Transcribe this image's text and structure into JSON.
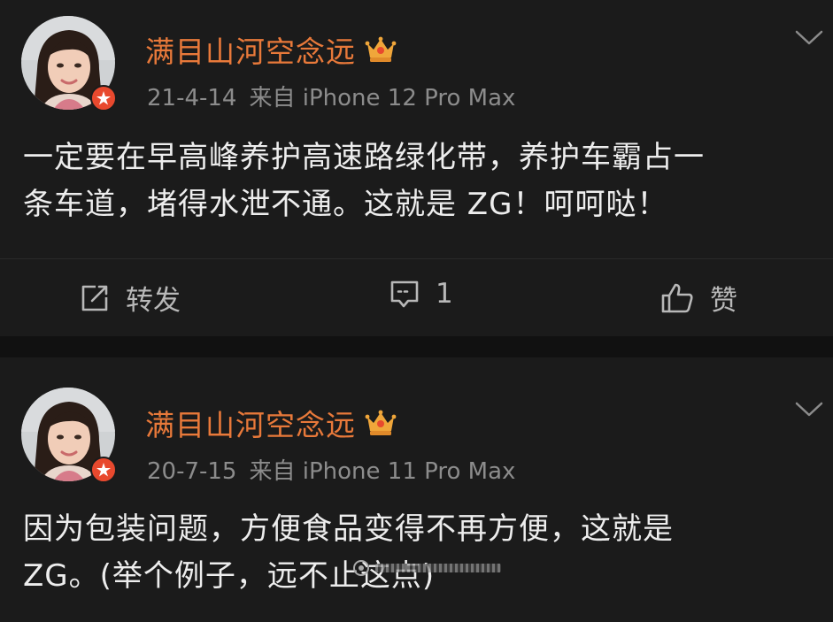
{
  "posts": [
    {
      "username": "满目山河空念远",
      "date": "21-4-14",
      "source": "来自 iPhone 12 Pro Max",
      "text": "一定要在早高峰养护高速路绿化带，养护车霸占一\n条车道，堵得水泄不通。这就是 ZG！呵呵哒！",
      "actions": {
        "repost_label": "转发",
        "comment_count": "1",
        "like_label": "赞"
      }
    },
    {
      "username": "满目山河空念远",
      "date": "20-7-15",
      "source": "来自 iPhone 11 Pro Max",
      "text": "因为包装问题，方便食品变得不再方便，这就是\nZG。(举个例子，远不止这点)"
    }
  ],
  "colors": {
    "username": "#e8793a",
    "meta": "#8c8c8c",
    "text": "#ededed",
    "background": "#1b1b1b"
  }
}
